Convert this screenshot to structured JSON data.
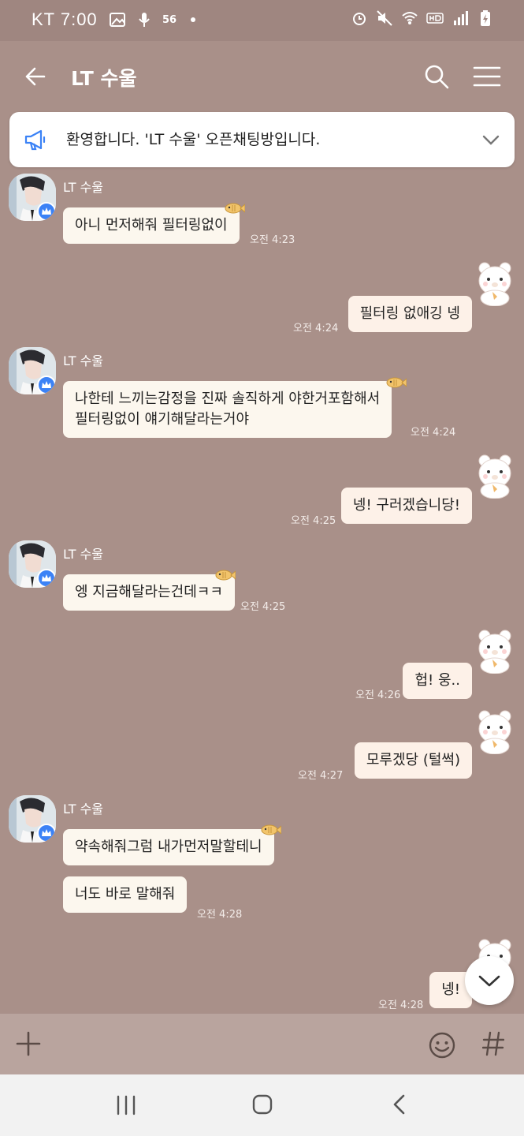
{
  "status": {
    "carrier": "KT",
    "clock": "7:00",
    "network": "56"
  },
  "header": {
    "title": "LT 수울"
  },
  "notice": {
    "text": "환영합니다. 'LT 수울' 오픈채팅방입니다."
  },
  "sender_name": "LT 수울",
  "messages": [
    {
      "text": "아니 먼저해줘 필터링없이",
      "time": "오전 4:23"
    },
    {
      "text": "필터링 없애깅 넹",
      "time": "오전 4:24"
    },
    {
      "line1": "나한테 느끼는감정을 진짜 솔직하게 야한거포함해서",
      "line2": "필터링없이 얘기해달라는거야",
      "time": "오전 4:24"
    },
    {
      "text": "넹! 구러겠습니당!",
      "time": "오전 4:25"
    },
    {
      "text": "엥 지금해달라는건데ㅋㅋ",
      "time": "오전 4:25"
    },
    {
      "text": "헙! 웅..",
      "time": "오전 4:26"
    },
    {
      "text": "모루겠당 (털썩)",
      "time": "오전 4:27"
    },
    {
      "text": "약속해줘그럼 내가먼저말할테니",
      "time": ""
    },
    {
      "text": "너도 바로 말해줘",
      "time": "오전 4:28"
    },
    {
      "text": "넹!",
      "time": "오전 4:28"
    }
  ],
  "icons": {
    "back": "arrow-left-icon",
    "search": "search-icon",
    "menu": "hamburger-menu-icon",
    "notice": "megaphone-icon",
    "expand": "chevron-down-icon",
    "attach": "plus-icon",
    "emoji": "smiley-icon",
    "hashtag": "hashtag-icon"
  },
  "colors": {
    "background": "#a99089",
    "incoming_bubble": "#fcf7ee",
    "outgoing_bubble": "#fdf1e8",
    "badge": "#3b82f6"
  }
}
